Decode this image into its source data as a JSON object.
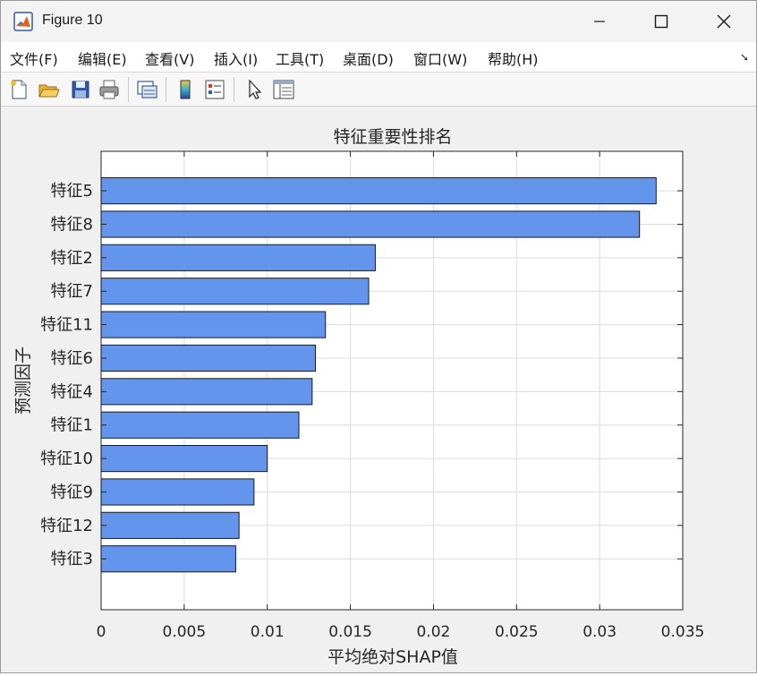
{
  "window": {
    "title": "Figure 10"
  },
  "menu": {
    "items": [
      "文件(F)",
      "编辑(E)",
      "查看(V)",
      "插入(I)",
      "工具(T)",
      "桌面(D)",
      "窗口(W)",
      "帮助(H)"
    ]
  },
  "toolbar": {
    "buttons": [
      "new-figure-icon",
      "open-file-icon",
      "save-icon",
      "print-icon",
      "link-plot-icon",
      "colorbar-icon",
      "legend-icon",
      "pointer-icon",
      "property-inspector-icon"
    ]
  },
  "colors": {
    "bar_fill": "#6495ED",
    "bar_edge": "#1a1a1a",
    "grid": "#dcdcdc"
  },
  "chart_data": {
    "type": "bar",
    "orientation": "horizontal",
    "title": "特征重要性排名",
    "xlabel": "平均绝对SHAP值",
    "ylabel": "预测因子",
    "categories": [
      "特征5",
      "特征8",
      "特征2",
      "特征7",
      "特征11",
      "特征6",
      "特征4",
      "特征1",
      "特征10",
      "特征9",
      "特征12",
      "特征3"
    ],
    "values": [
      0.0334,
      0.0324,
      0.0165,
      0.0161,
      0.0135,
      0.0129,
      0.0127,
      0.0119,
      0.01,
      0.0092,
      0.0083,
      0.0081
    ],
    "xlim": [
      0,
      0.035
    ],
    "xticks": [
      "0",
      "0.005",
      "0.01",
      "0.015",
      "0.02",
      "0.025",
      "0.03",
      "0.035"
    ],
    "grid": true
  }
}
